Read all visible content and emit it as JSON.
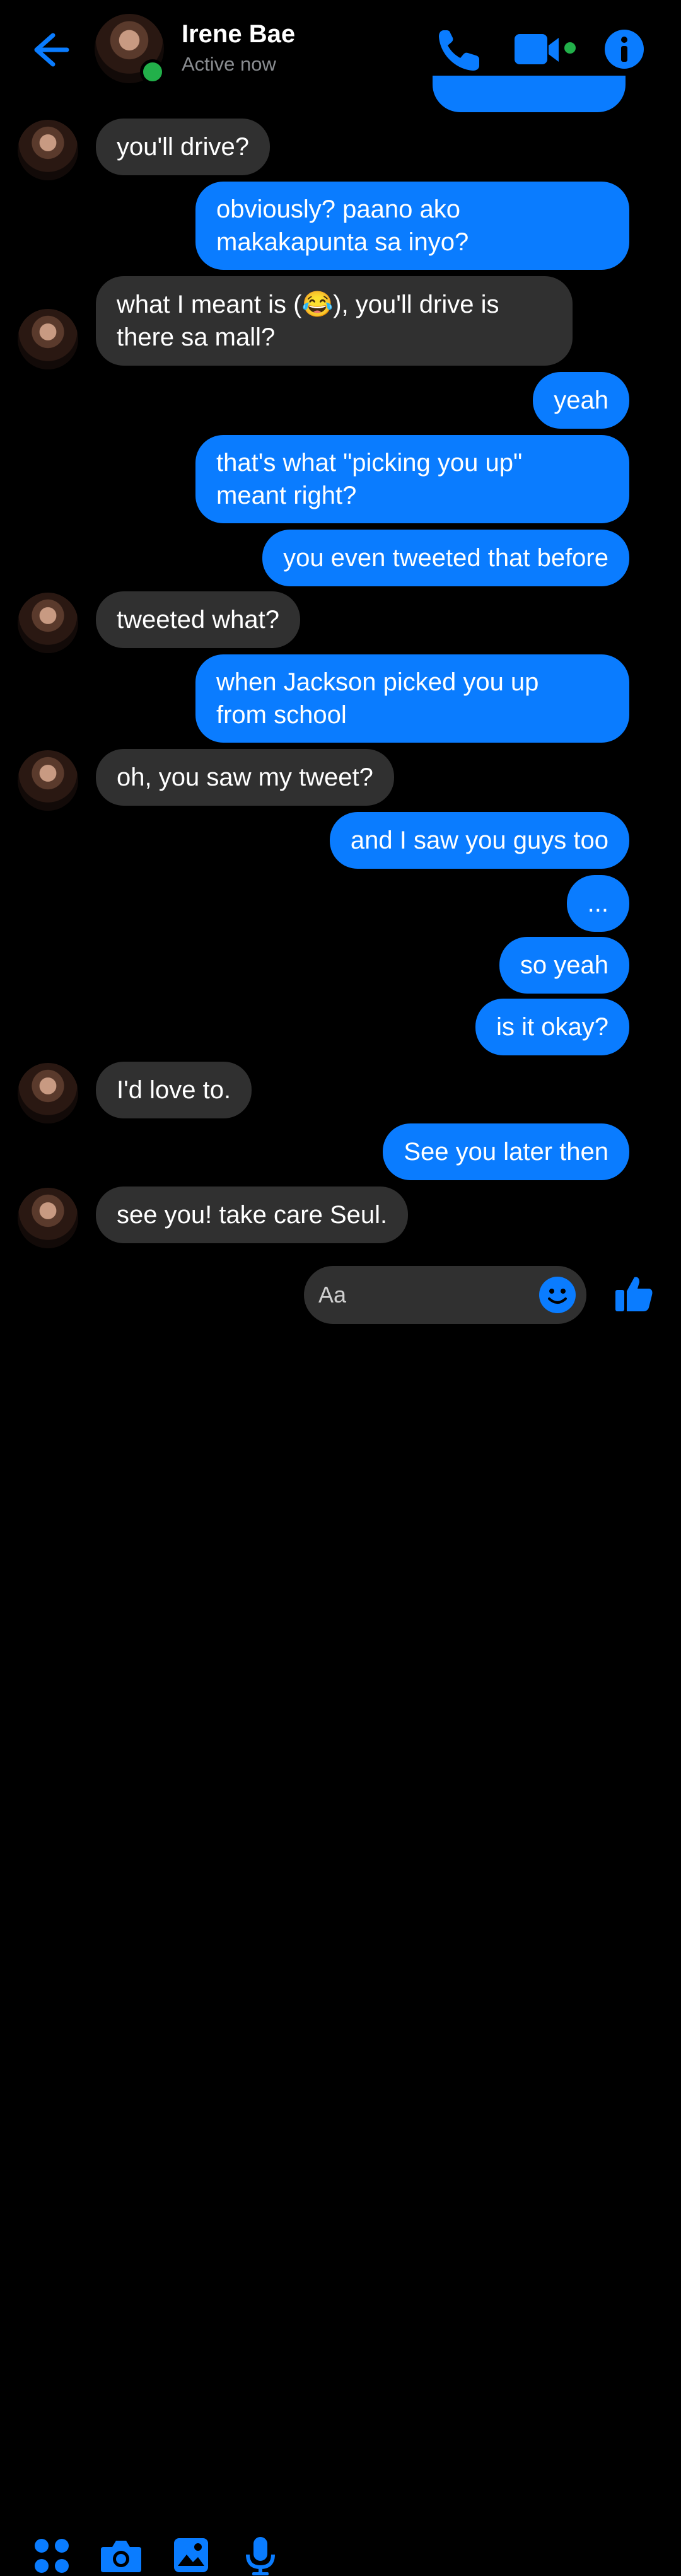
{
  "header": {
    "contact_name": "Irene Bae",
    "status": "Active now",
    "icons": [
      "back-arrow-icon",
      "phone-icon",
      "video-camera-icon",
      "info-icon"
    ]
  },
  "accent_color": "#0a7cff",
  "incoming_bubble_color": "#303030",
  "messages": [
    {
      "sender": "them",
      "text": "you'll drive?"
    },
    {
      "sender": "me",
      "lines": [
        "obviously? paano ako",
        "makakapunta sa inyo?"
      ]
    },
    {
      "sender": "them",
      "lines": [
        "what I meant is (😂), you'll drive is",
        "there sa mall?"
      ]
    },
    {
      "sender": "me",
      "text": "yeah"
    },
    {
      "sender": "me",
      "lines": [
        "that's what \"picking you up\"",
        "meant right?"
      ]
    },
    {
      "sender": "me",
      "text": "you even tweeted that before"
    },
    {
      "sender": "them",
      "text": "tweeted what?"
    },
    {
      "sender": "me",
      "lines": [
        "when Jackson picked you up",
        "from school"
      ]
    },
    {
      "sender": "them",
      "text": "oh, you saw my tweet?"
    },
    {
      "sender": "me",
      "text": "and I saw you guys too"
    },
    {
      "sender": "me",
      "text": "..."
    },
    {
      "sender": "me",
      "text": "so yeah"
    },
    {
      "sender": "me",
      "text": "is it okay?"
    },
    {
      "sender": "them",
      "text": "I'd love to."
    },
    {
      "sender": "me",
      "text": "See you later then"
    },
    {
      "sender": "them",
      "text": "see you! take care Seul."
    }
  ],
  "composer": {
    "placeholder": "Aa",
    "icons": [
      "apps-grid-icon",
      "camera-icon",
      "gallery-icon",
      "microphone-icon",
      "emoji-icon",
      "thumbs-up-icon"
    ]
  }
}
